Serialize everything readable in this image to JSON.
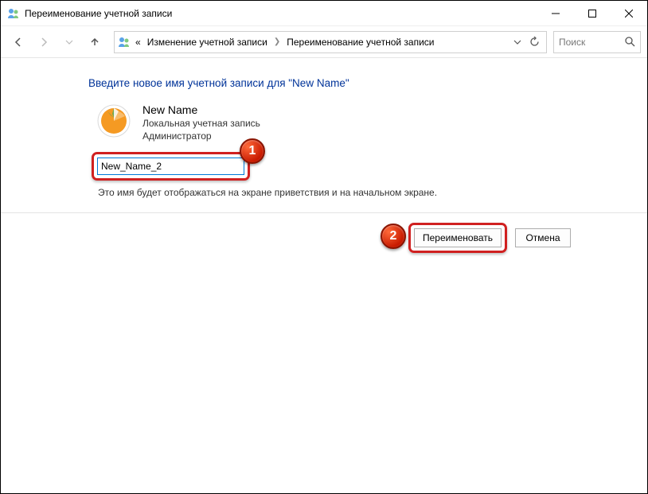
{
  "titlebar": {
    "title": "Переименование учетной записи"
  },
  "nav": {
    "breadcrumb_prefix": "«",
    "crumb1": "Изменение учетной записи",
    "crumb2": "Переименование учетной записи",
    "search_placeholder": "Поиск"
  },
  "content": {
    "heading": "Введите новое имя учетной записи для \"New Name\"",
    "account_name": "New Name",
    "account_type": "Локальная учетная запись",
    "account_role": "Администратор",
    "input_value": "New_Name_2",
    "hint": "Это имя будет отображаться на экране приветствия и на начальном экране."
  },
  "buttons": {
    "rename": "Переименовать",
    "cancel": "Отмена"
  },
  "annotations": {
    "step1": "1",
    "step2": "2"
  }
}
